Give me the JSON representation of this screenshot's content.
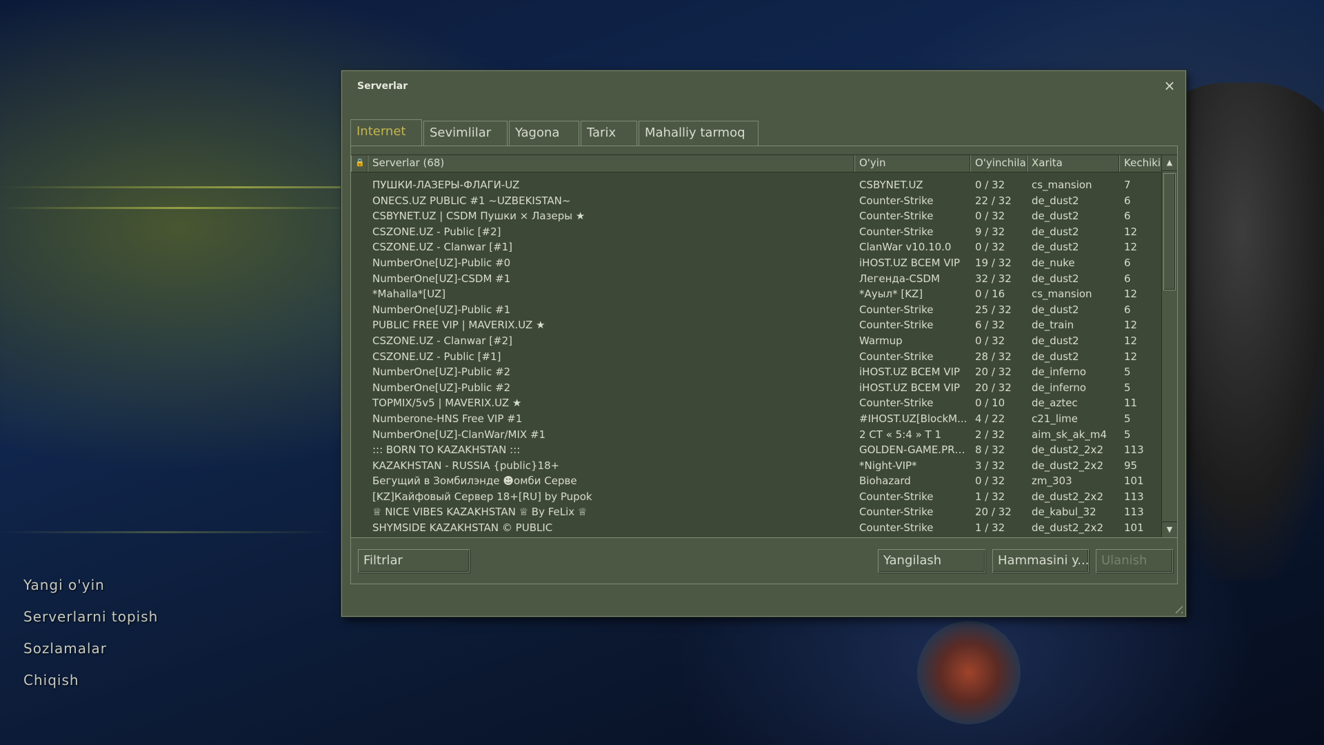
{
  "main_menu": {
    "items": [
      "Yangi o'yin",
      "Serverlarni topish",
      "Sozlamalar",
      "Chiqish"
    ]
  },
  "dialog": {
    "title": "Serverlar",
    "close_icon": "×"
  },
  "tabs": [
    {
      "label": "Internet",
      "active": true
    },
    {
      "label": "Sevimlilar",
      "active": false
    },
    {
      "label": "Yagona",
      "active": false
    },
    {
      "label": "Tarix",
      "active": false
    },
    {
      "label": "Mahalliy tarmoq",
      "active": false
    }
  ],
  "columns": {
    "lock_icon": "🔒",
    "name": "Serverlar (68)",
    "game": "O'yin",
    "players": "O'yinchilar",
    "map": "Xarita",
    "ping": "Kechikish"
  },
  "servers": [
    {
      "name": "ПУШКИ-ЛАЗЕРЫ-ФЛАГИ-UZ",
      "game": "CSBYNET.UZ",
      "players": "0 / 32",
      "map": "cs_mansion",
      "ping": "7"
    },
    {
      "name": "ONECS.UZ PUBLIC #1 ~UZBEKISTAN~",
      "game": "Counter-Strike",
      "players": "22 / 32",
      "map": "de_dust2",
      "ping": "6"
    },
    {
      "name": "CSBYNET.UZ | CSDM Пушки × Лазеры ★",
      "game": "Counter-Strike",
      "players": "0 / 32",
      "map": "de_dust2",
      "ping": "6"
    },
    {
      "name": "CSZONE.UZ - Public [#2]",
      "game": "Counter-Strike",
      "players": "9 / 32",
      "map": "de_dust2",
      "ping": "12"
    },
    {
      "name": "CSZONE.UZ - Clanwar [#1]",
      "game": "ClanWar v10.10.0",
      "players": "0 / 32",
      "map": "de_dust2",
      "ping": "12"
    },
    {
      "name": "NumberOne[UZ]-Public #0",
      "game": "iHOST.UZ BCEM VIP",
      "players": "19 / 32",
      "map": "de_nuke",
      "ping": "6"
    },
    {
      "name": "NumberOne[UZ]-CSDM #1",
      "game": "Легенда-CSDM",
      "players": "32 / 32",
      "map": "de_dust2",
      "ping": "6"
    },
    {
      "name": "*Mahalla*[UZ]",
      "game": "*Ауыл* [KZ]",
      "players": "0 / 16",
      "map": "cs_mansion",
      "ping": "12"
    },
    {
      "name": "NumberOne[UZ]-Public #1",
      "game": "Counter-Strike",
      "players": "25 / 32",
      "map": "de_dust2",
      "ping": "6"
    },
    {
      "name": "PUBLIC FREE VIP | MAVERIX.UZ ★",
      "game": "Counter-Strike",
      "players": "6 / 32",
      "map": "de_train",
      "ping": "12"
    },
    {
      "name": "CSZONE.UZ - Clanwar [#2]",
      "game": "Warmup",
      "players": "0 / 32",
      "map": "de_dust2",
      "ping": "12"
    },
    {
      "name": "CSZONE.UZ - Public [#1]",
      "game": "Counter-Strike",
      "players": "28 / 32",
      "map": "de_dust2",
      "ping": "12"
    },
    {
      "name": "NumberOne[UZ]-Public #2",
      "game": "iHOST.UZ BCEM VIP",
      "players": "20 / 32",
      "map": "de_inferno",
      "ping": "5"
    },
    {
      "name": "NumberOne[UZ]-Public #2",
      "game": "iHOST.UZ BCEM VIP",
      "players": "20 / 32",
      "map": "de_inferno",
      "ping": "5"
    },
    {
      "name": "TOPMIX/5v5 | MAVERIX.UZ ★",
      "game": "Counter-Strike",
      "players": "0 / 10",
      "map": "de_aztec",
      "ping": "11"
    },
    {
      "name": "Numberone-HNS Free VIP  #1",
      "game": "#IHOST.UZ[BlockM...",
      "players": "4 / 22",
      "map": "c21_lime",
      "ping": "5"
    },
    {
      "name": "NumberOne[UZ]-ClanWar/MIX #1",
      "game": "2 CT « 5:4 » T 1",
      "players": "2 / 32",
      "map": "aim_sk_ak_m4",
      "ping": "5"
    },
    {
      "name": "::: BORN TO KAZAKHSTAN :::",
      "game": "GOLDEN-GAME.PRO ▶",
      "players": "8 / 32",
      "map": "de_dust2_2x2",
      "ping": "113"
    },
    {
      "name": "KAZAKHSTAN - RUSSIA {public}18+",
      "game": "*Night-VIP*",
      "players": "3 / 32",
      "map": "de_dust2_2x2",
      "ping": "95"
    },
    {
      "name": "Бегущий в Зомбилэнде ☻омби Серве",
      "game": "Biohazard",
      "players": "0 / 32",
      "map": "zm_303",
      "ping": "101"
    },
    {
      "name": "[KZ]Кайфовый Сервер 18+[RU] by Pupok",
      "game": "Counter-Strike",
      "players": "1 / 32",
      "map": "de_dust2_2x2",
      "ping": "113"
    },
    {
      "name": "♕ NICE VIBES KAZAKHSTAN ♕ By FeLix ♕",
      "game": "Counter-Strike",
      "players": "20 / 32",
      "map": "de_kabul_32",
      "ping": "113"
    },
    {
      "name": "SHYMSIDE KAZAKHSTAN © PUBLIC",
      "game": "Counter-Strike",
      "players": "1 / 32",
      "map": "de_dust2_2x2",
      "ping": "101"
    }
  ],
  "scrollbar": {
    "up_icon": "▲",
    "down_icon": "▼"
  },
  "buttons": {
    "filters": "Filtrlar",
    "refresh": "Yangilash",
    "refresh_all": "Hammasini y...",
    "connect": "Ulanish"
  },
  "colors": {
    "panel": "#4c5844",
    "list_bg": "#3e4837",
    "text": "#d8dccf",
    "active_tab": "#c4b550",
    "disabled_text": "#78836d"
  }
}
